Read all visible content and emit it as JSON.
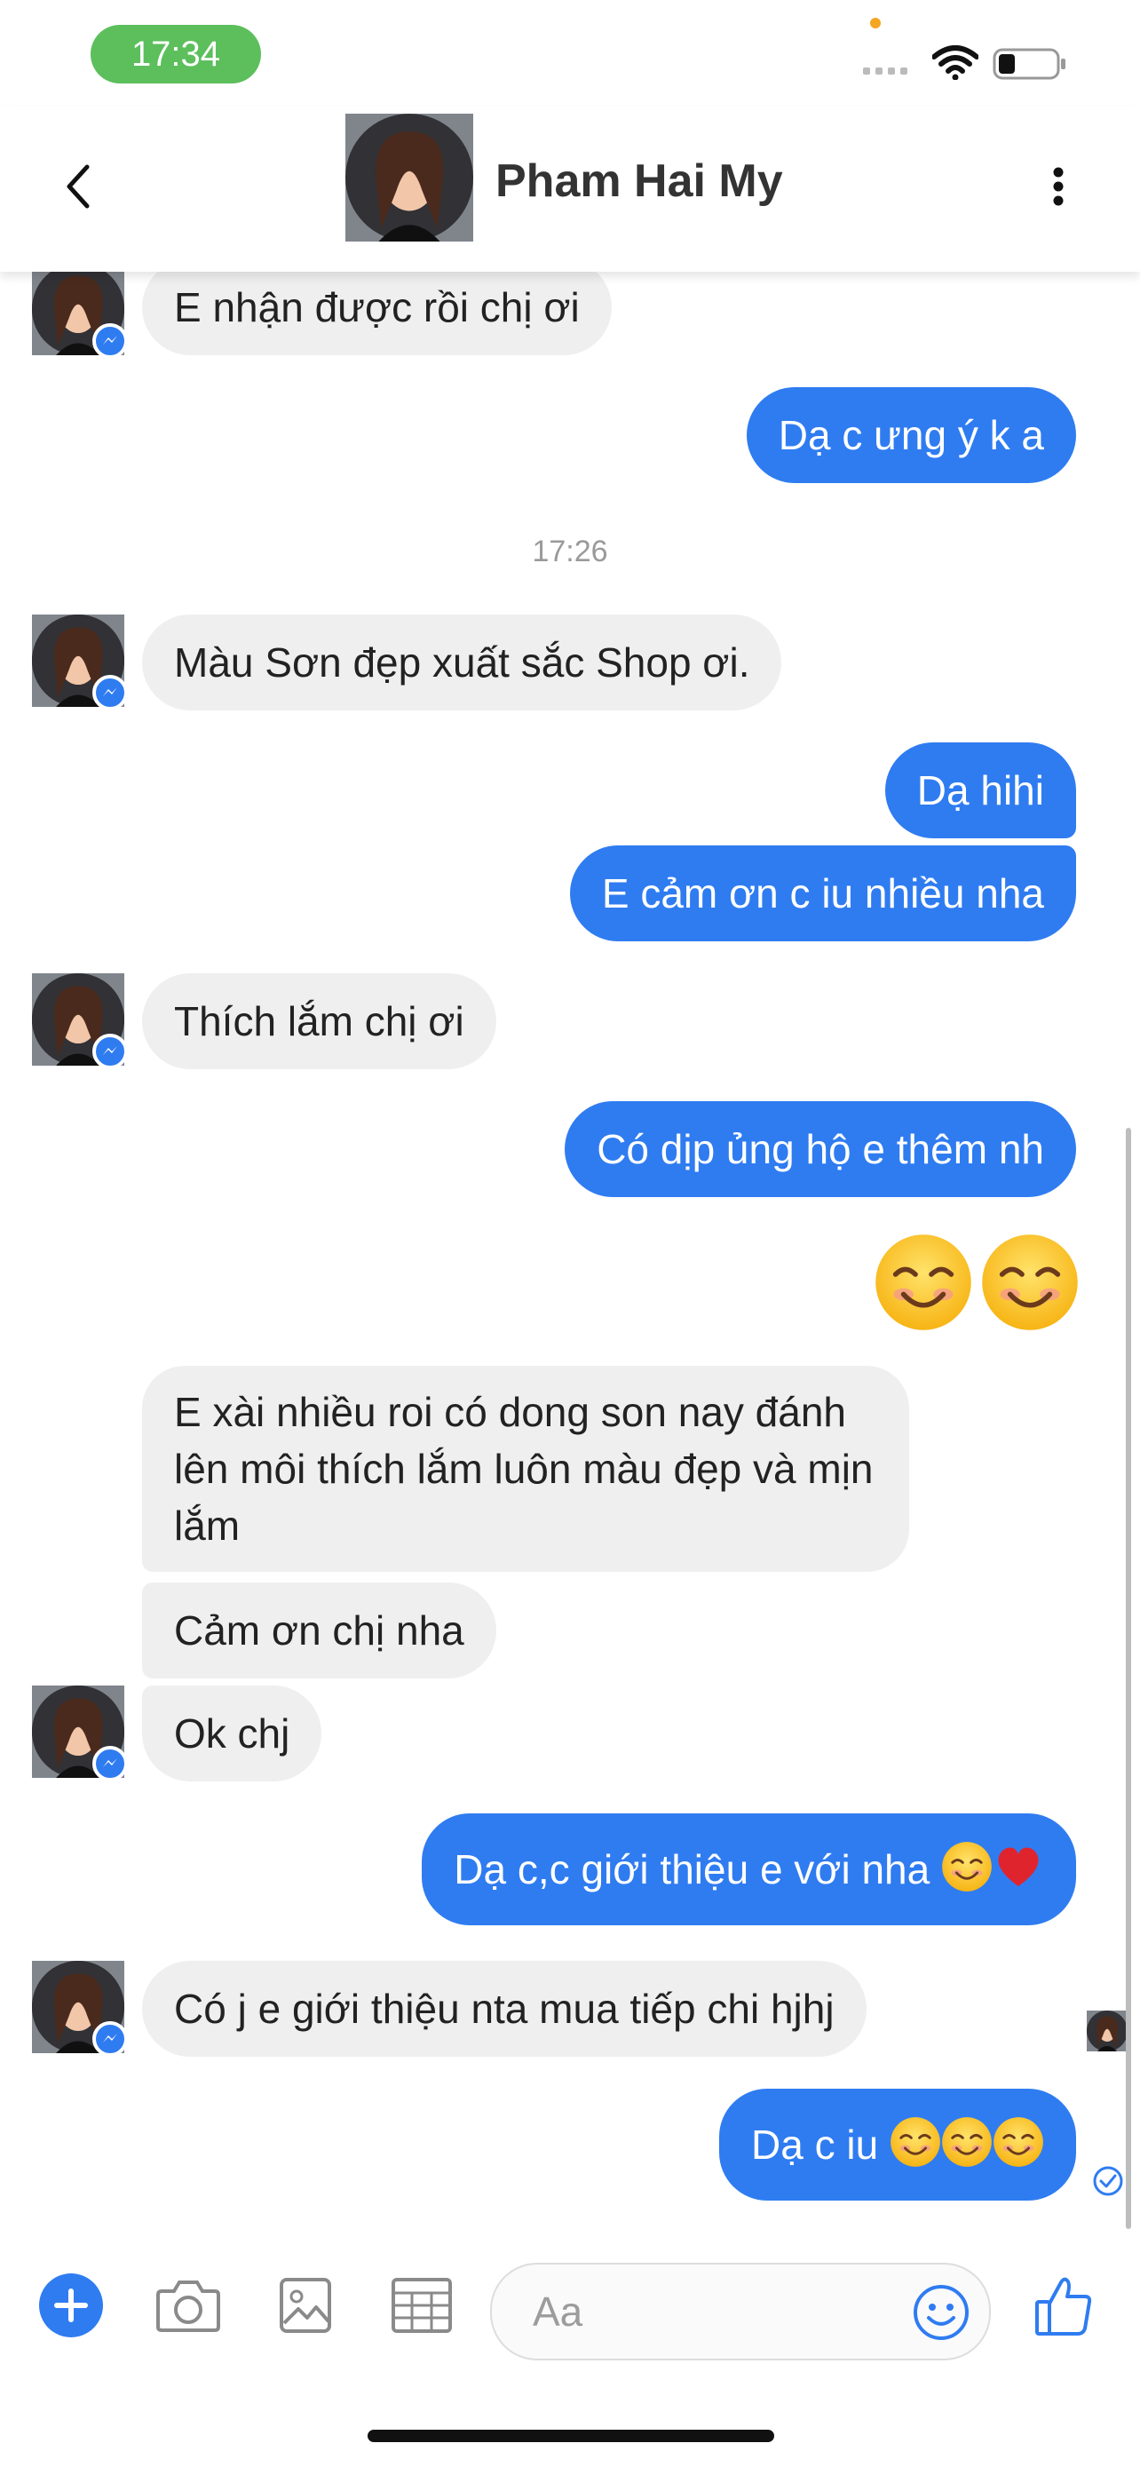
{
  "status_bar": {
    "time": "17:34"
  },
  "header": {
    "contact_name": "Pham Hai My"
  },
  "chat": {
    "timestamp": "17:26",
    "messages": [
      {
        "dir": "in",
        "text": "E nhận được rồi chị ơi"
      },
      {
        "dir": "out",
        "text": "Dạ c ưng ý k a"
      },
      {
        "dir": "in",
        "text": "Màu Sơn đẹp xuất sắc Shop ơi."
      },
      {
        "dir": "out",
        "text": "Dạ hihi"
      },
      {
        "dir": "out",
        "text": "E cảm ơn c iu nhiều nha"
      },
      {
        "dir": "in",
        "text": "Thích lắm chị ơi"
      },
      {
        "dir": "out",
        "text": "Có dịp ủng hộ e thêm nh"
      },
      {
        "dir": "in",
        "text": "E xài nhiều roi có dong son nay đánh lên môi thích lắm luôn màu đẹp và mịn lắm"
      },
      {
        "dir": "in",
        "text": "Cảm ơn chị nha"
      },
      {
        "dir": "in",
        "text": "Ok chj"
      },
      {
        "dir": "out",
        "text": "Dạ c,c giới thiệu e với nha"
      },
      {
        "dir": "in",
        "text": "Có j e giới thiệu nta mua tiếp chi hjhj"
      },
      {
        "dir": "out",
        "text": "Dạ c iu"
      }
    ]
  },
  "composer": {
    "placeholder": "Aa"
  },
  "colors": {
    "accent": "#2f7cf1",
    "incoming_bubble": "#efefef",
    "status_pill": "#5cbf5c"
  }
}
